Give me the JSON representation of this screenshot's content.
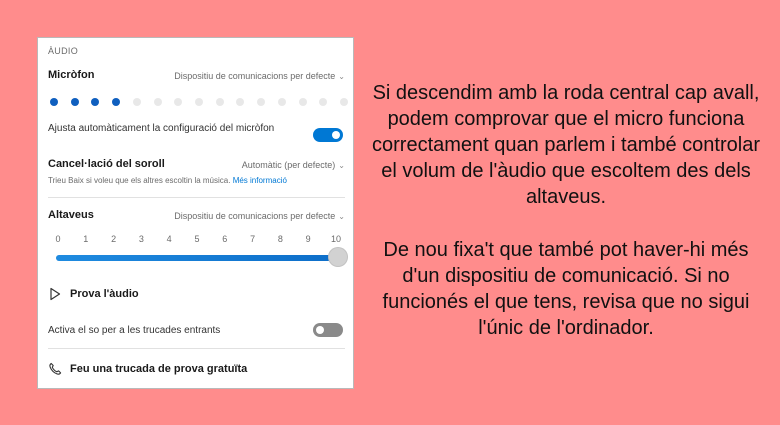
{
  "panel": {
    "section_label": "ÀUDIO",
    "microphone": {
      "title": "Micròfon",
      "device": "Dispositiu de comunicacions per defecte",
      "level_active_dots": 4,
      "level_total_dots": 15
    },
    "auto_adjust": {
      "label": "Ajusta automàticament la configuració del micròfon",
      "enabled": true
    },
    "noise_cancel": {
      "title": "Cancel·lació del soroll",
      "value": "Automàtic (per defecte)",
      "hint": "Trieu Baix si voleu que els altres escoltin la música.",
      "hint_link": "Més informació"
    },
    "speakers": {
      "title": "Altaveus",
      "device": "Dispositiu de comunicacions per defecte",
      "scale_labels": [
        "0",
        "1",
        "2",
        "3",
        "4",
        "5",
        "6",
        "7",
        "8",
        "9",
        "10"
      ],
      "volume": 10,
      "volume_max": 10
    },
    "test_audio": {
      "label": "Prova l'àudio",
      "icon": "play-icon"
    },
    "incoming_ring": {
      "label": "Activa el so per a les trucades entrants",
      "enabled": false
    },
    "test_call": {
      "label": "Feu una trucada de prova gratuïta",
      "icon": "phone-icon"
    }
  },
  "explanation": {
    "paragraph1": "Si descendim amb la roda central cap avall, podem comprovar que el micro funciona correctament quan parlem i també controlar el volum de l'àudio que escoltem des dels altaveus.",
    "paragraph2": "De nou fixa't que també pot haver-hi més d'un dispositiu de comunicació. Si no funcionés el que tens, revisa que no sigui l'únic de l'ordinador."
  },
  "colors": {
    "background": "#ff8c8c",
    "accent": "#0078d4",
    "mic_level": "#0f5fbf"
  }
}
